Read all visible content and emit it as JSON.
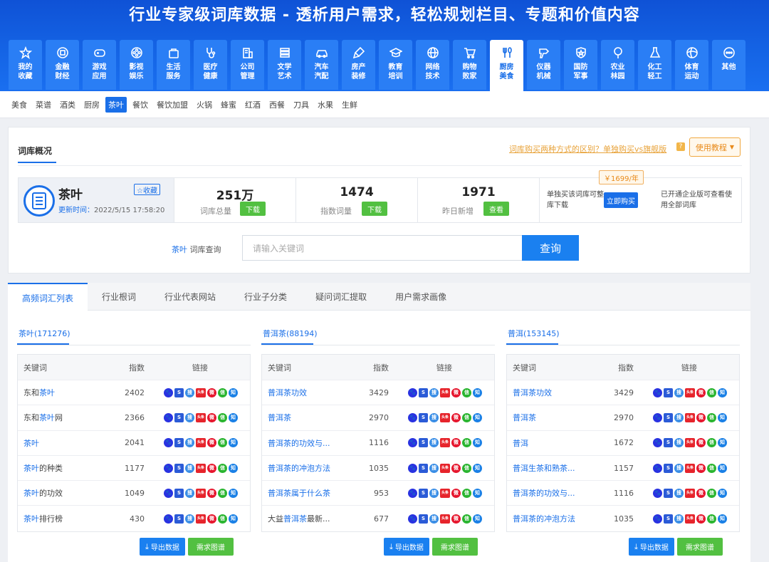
{
  "banner": {
    "title": "行业专家级词库数据 - 透析用户需求，轻松规划栏目、专题和价值内容"
  },
  "categories": [
    {
      "label": "我的收藏",
      "icon": "star-icon"
    },
    {
      "label": "金融财经",
      "icon": "coin-icon"
    },
    {
      "label": "游戏应用",
      "icon": "gamepad-icon"
    },
    {
      "label": "影视娱乐",
      "icon": "film-reel-icon"
    },
    {
      "label": "生活服务",
      "icon": "bag-icon"
    },
    {
      "label": "医疗健康",
      "icon": "stethoscope-icon"
    },
    {
      "label": "公司管理",
      "icon": "building-icon"
    },
    {
      "label": "文学艺术",
      "icon": "books-icon"
    },
    {
      "label": "汽车汽配",
      "icon": "car-icon"
    },
    {
      "label": "房产装修",
      "icon": "brush-icon"
    },
    {
      "label": "教育培训",
      "icon": "graduation-cap-icon"
    },
    {
      "label": "网络技术",
      "icon": "globe-icon"
    },
    {
      "label": "购物败家",
      "icon": "cart-icon"
    },
    {
      "label": "厨房美食",
      "icon": "utensils-icon",
      "active": true
    },
    {
      "label": "仪器机械",
      "icon": "drill-icon"
    },
    {
      "label": "国防军事",
      "icon": "shield-star-icon"
    },
    {
      "label": "农业林园",
      "icon": "tree-icon"
    },
    {
      "label": "化工轻工",
      "icon": "flask-icon"
    },
    {
      "label": "体育运动",
      "icon": "ball-icon"
    },
    {
      "label": "其他",
      "icon": "more-dots-icon"
    }
  ],
  "subcategories": [
    "美食",
    "菜谱",
    "酒类",
    "厨房",
    "茶叶",
    "餐饮",
    "餐饮加盟",
    "火锅",
    "蜂蜜",
    "红酒",
    "西餐",
    "刀具",
    "水果",
    "生鲜"
  ],
  "subcategory_active": "茶叶",
  "overview": {
    "title": "词库概况",
    "question_link": "词库购买两种方式的区别？单独购买vs旗舰版",
    "question_icon": "?",
    "tutorial_label": "使用教程",
    "name": "茶叶",
    "favorite_label": "☆收藏",
    "update_label": "更新时间：",
    "update_time": "2022/5/15 17:58:20",
    "stats": [
      {
        "value": "251万",
        "label": "词库总量",
        "button": "下载"
      },
      {
        "value": "1474",
        "label": "指数词量",
        "button": "下载"
      },
      {
        "value": "1971",
        "label": "昨日新增",
        "button": "查看"
      }
    ],
    "buy_text": "单独买该词库可整库下载",
    "price": "￥1699/年",
    "buy_button": "立即购买",
    "enterprise_text": "已开通企业版可查看使用全部词库",
    "query_keyword": "茶叶",
    "query_label": " 词库查询",
    "query_placeholder": "请输入关键词",
    "query_button": "查询"
  },
  "tabs": [
    "高频词汇列表",
    "行业根词",
    "行业代表网站",
    "行业子分类",
    "疑问词汇提取",
    "用户需求画像"
  ],
  "tab_active": "高频词汇列表",
  "table_headers": {
    "keyword": "关键词",
    "index": "指数",
    "links": "链接"
  },
  "link_icons": [
    {
      "name": "baidu-icon",
      "glyph": "🐾",
      "color": "#2932e1"
    },
    {
      "name": "sogou-icon",
      "glyph": "S",
      "color": "#2b5bd7"
    },
    {
      "name": "so360-icon",
      "glyph": "搜",
      "color": "#3a8ee6"
    },
    {
      "name": "toutiao-icon",
      "glyph": "头条",
      "color": "#e6242b"
    },
    {
      "name": "weibo-icon",
      "glyph": "微",
      "color": "#e6162d"
    },
    {
      "name": "wechat-icon",
      "glyph": "信",
      "color": "#2ab530"
    },
    {
      "name": "zhihu-icon",
      "glyph": "知",
      "color": "#1a80e6"
    }
  ],
  "columns": [
    {
      "head": "茶叶(171276)",
      "rows": [
        {
          "pre": "东和",
          "hl": "茶叶",
          "post": "",
          "index": "2402"
        },
        {
          "pre": "东和",
          "hl": "茶叶",
          "post": "网",
          "index": "2366",
          "plain": true
        },
        {
          "pre": "",
          "hl": "茶叶",
          "post": "",
          "index": "2041"
        },
        {
          "pre": "",
          "hl": "茶叶",
          "post": "的种类",
          "index": "1177"
        },
        {
          "pre": "",
          "hl": "茶叶",
          "post": "的功效",
          "index": "1049"
        },
        {
          "pre": "",
          "hl": "茶叶",
          "post": "排行榜",
          "index": "430"
        }
      ]
    },
    {
      "head": "普洱茶(88194)",
      "rows": [
        {
          "pre": "",
          "hl": "普洱茶",
          "post": "功效",
          "index": "3429"
        },
        {
          "pre": "",
          "hl": "普洱茶",
          "post": "",
          "index": "2970"
        },
        {
          "pre": "",
          "hl": "普洱茶",
          "post": "的功效与...",
          "index": "1116"
        },
        {
          "pre": "",
          "hl": "普洱茶",
          "post": "的冲泡方法",
          "index": "1035"
        },
        {
          "pre": "",
          "hl": "普洱茶",
          "post": "属于什么茶",
          "index": "953"
        },
        {
          "pre": "大益",
          "hl": "普洱茶",
          "post": "最新...",
          "index": "677"
        }
      ]
    },
    {
      "head": "普洱(153145)",
      "rows": [
        {
          "pre": "",
          "hl": "普洱",
          "post": "茶功效",
          "index": "3429"
        },
        {
          "pre": "",
          "hl": "普洱",
          "post": "茶",
          "index": "2970"
        },
        {
          "pre": "",
          "hl": "普洱",
          "post": "",
          "index": "1672"
        },
        {
          "pre": "",
          "hl": "普洱",
          "post": "生茶和熟茶...",
          "index": "1157"
        },
        {
          "pre": "",
          "hl": "普洱",
          "post": "茶的功效与...",
          "index": "1116"
        },
        {
          "pre": "",
          "hl": "普洱",
          "post": "茶的冲泡方法",
          "index": "1035"
        }
      ]
    }
  ],
  "export_label": "导出数据",
  "demand_label": "需求图谱",
  "colors": {
    "primary": "#1a6fe8",
    "green": "#52c041",
    "orange": "#e88a1a"
  }
}
